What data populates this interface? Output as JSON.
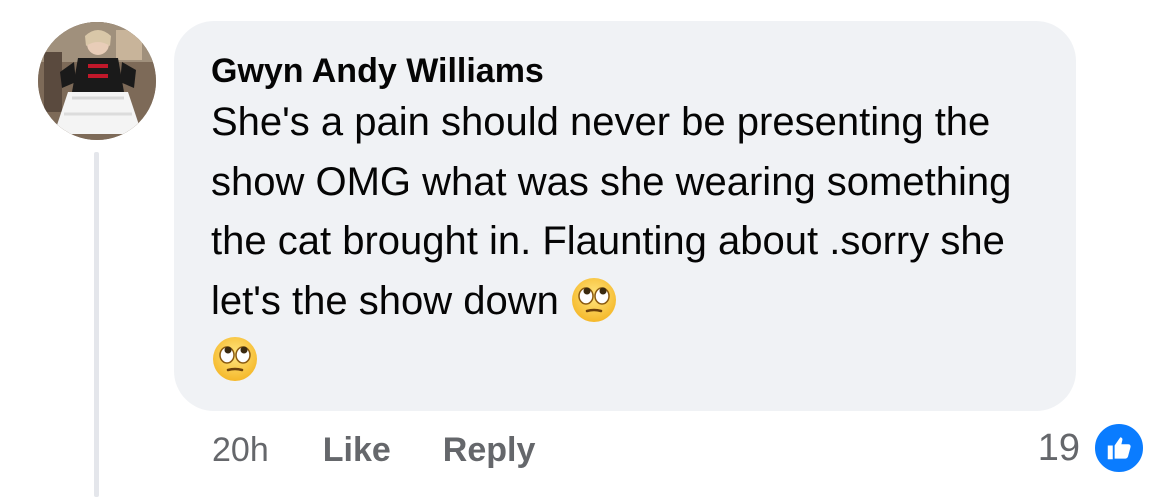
{
  "comment": {
    "author": "Gwyn Andy Williams",
    "text": "She's a pain should never be presenting the show OMG what was she wearing something the cat brought in. Flaunting about .sorry she let's the show down",
    "emojis": [
      "face-with-rolling-eyes",
      "face-with-rolling-eyes"
    ],
    "timestamp": "20h",
    "like_label": "Like",
    "reply_label": "Reply",
    "reaction_count": "19",
    "reaction_type": "like-icon"
  },
  "colors": {
    "bubble_bg": "#f0f2f5",
    "text": "#050505",
    "meta": "#65676b",
    "like_blue": "#0a7cff",
    "thread_line": "#e4e6eb"
  }
}
